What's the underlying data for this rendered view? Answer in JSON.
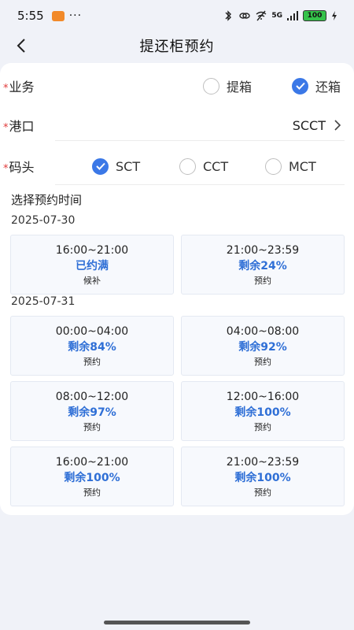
{
  "status_bar": {
    "time": "5:55",
    "dots": "···",
    "network": "5G",
    "battery": "100"
  },
  "nav": {
    "title": "提还柜预约"
  },
  "form": {
    "required_mark": "*",
    "business": {
      "label": "业务",
      "options": [
        "提箱",
        "还箱"
      ],
      "selected": "还箱"
    },
    "port": {
      "label": "港口",
      "value": "SCCT"
    },
    "terminal": {
      "label": "码头",
      "options": [
        "SCT",
        "CCT",
        "MCT"
      ],
      "selected": "SCT"
    }
  },
  "booking": {
    "title": "选择预约时间",
    "days": [
      {
        "date": "2025-07-30",
        "slots": [
          {
            "time": "16:00~21:00",
            "status": "已约满",
            "action": "候补"
          },
          {
            "time": "21:00~23:59",
            "status": "剩余24%",
            "action": "预约"
          }
        ]
      },
      {
        "date": "2025-07-31",
        "slots": [
          {
            "time": "00:00~04:00",
            "status": "剩余84%",
            "action": "预约"
          },
          {
            "time": "04:00~08:00",
            "status": "剩余92%",
            "action": "预约"
          },
          {
            "time": "08:00~12:00",
            "status": "剩余97%",
            "action": "预约"
          },
          {
            "time": "12:00~16:00",
            "status": "剩余100%",
            "action": "预约"
          },
          {
            "time": "16:00~21:00",
            "status": "剩余100%",
            "action": "预约"
          },
          {
            "time": "21:00~23:59",
            "status": "剩余100%",
            "action": "预约"
          }
        ]
      }
    ]
  },
  "colors": {
    "accent": "#3b78e7",
    "status_text": "#2f6fd6",
    "required": "#e03a3a",
    "background": "#f0f2f8"
  }
}
